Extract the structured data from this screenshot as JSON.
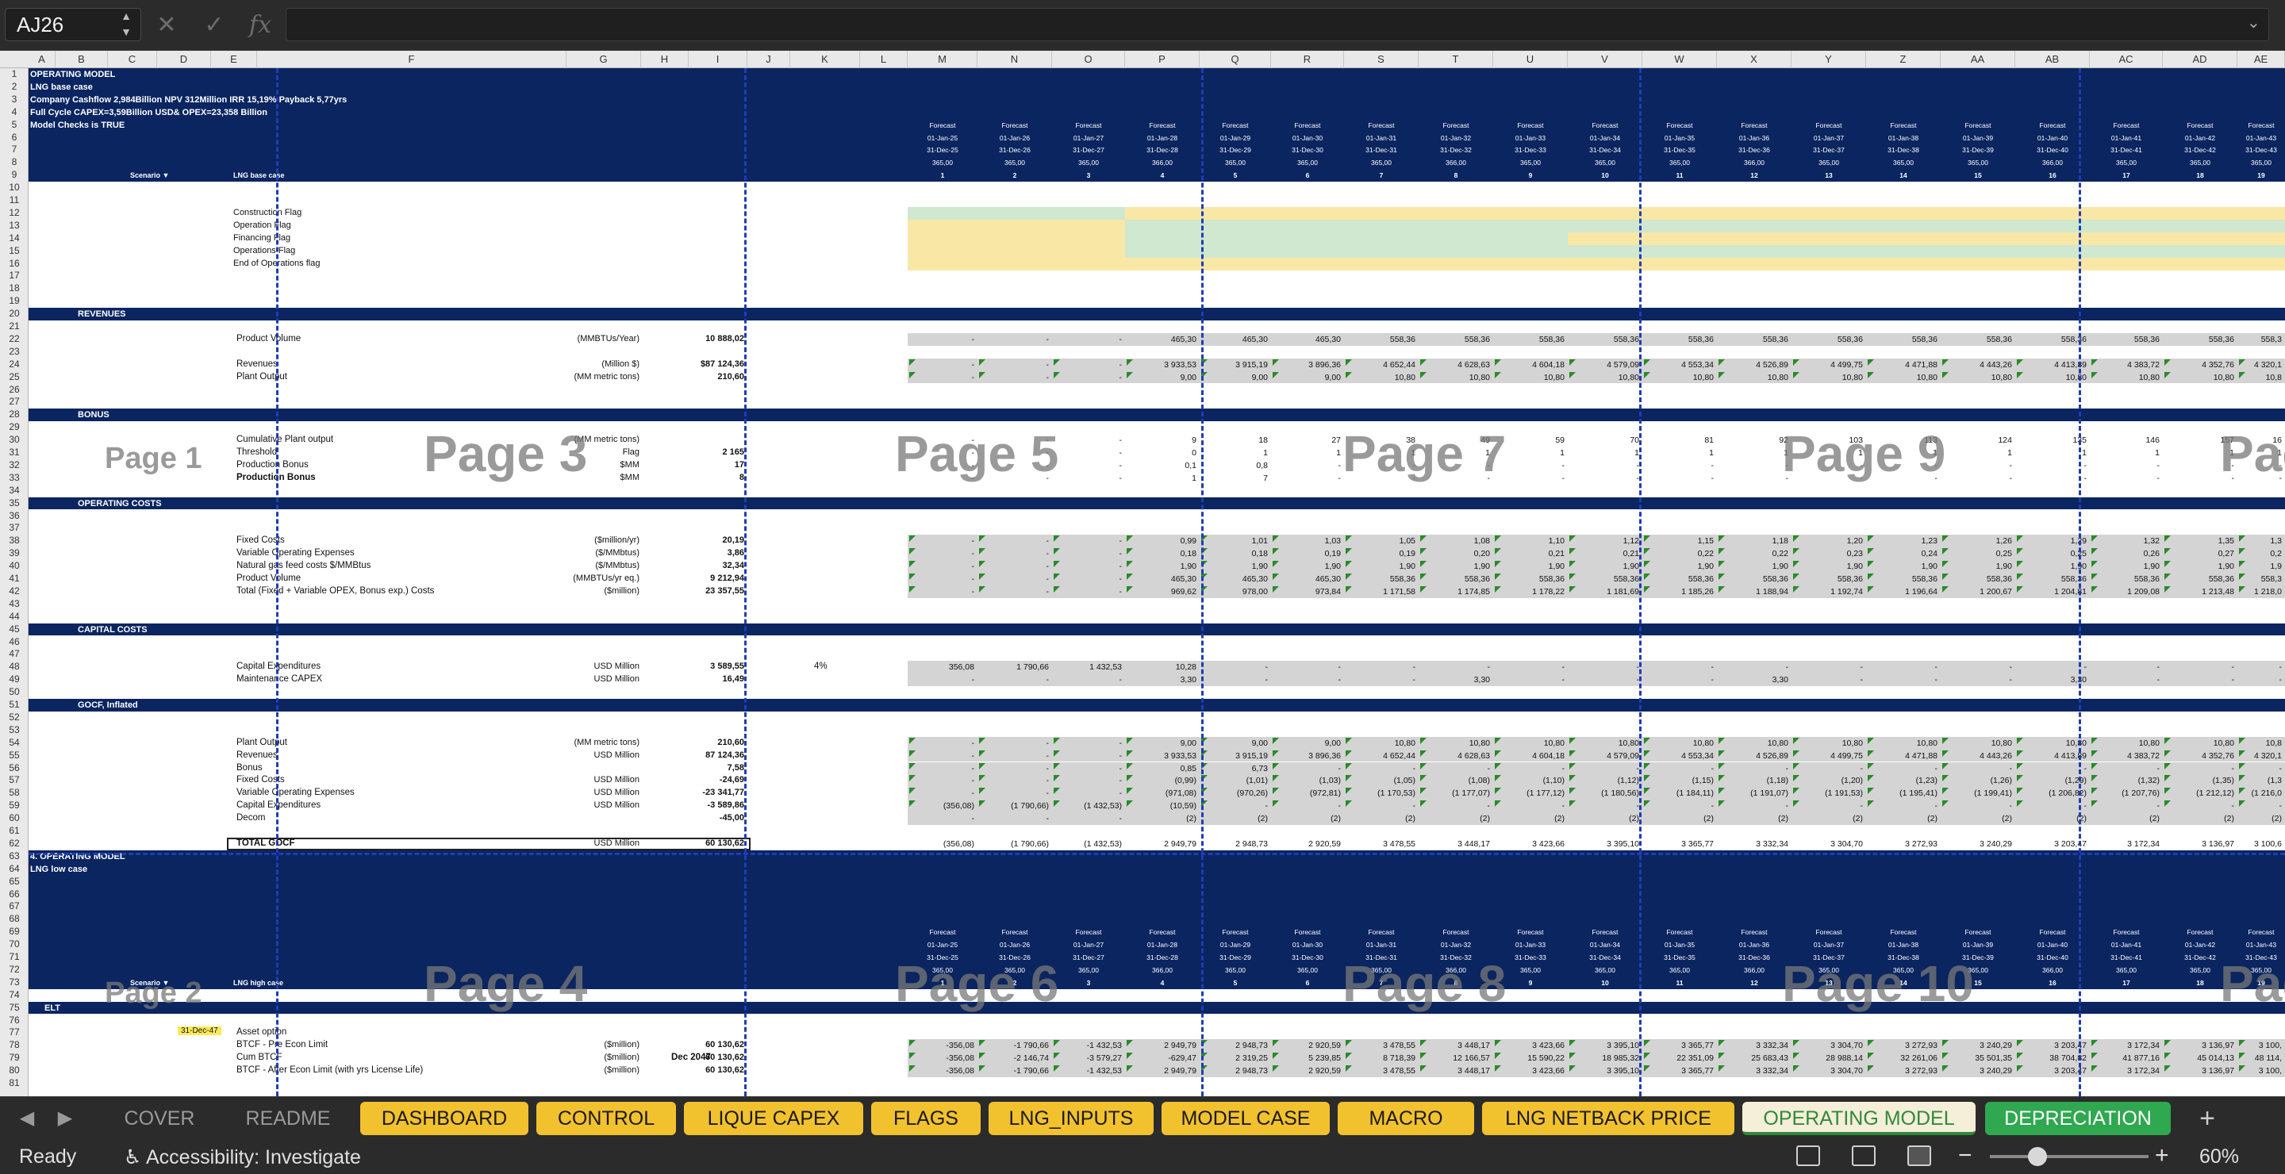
{
  "formula_bar": {
    "cell_ref": "AJ26",
    "formula": "",
    "cancel_icon": "x-icon",
    "enter_icon": "check-icon",
    "fx": "fx"
  },
  "columns": [
    "A",
    "B",
    "C",
    "D",
    "E",
    "F",
    "G",
    "H",
    "I",
    "J",
    "K",
    "L",
    "M",
    "N",
    "O",
    "P",
    "Q",
    "R",
    "S",
    "T",
    "U",
    "V",
    "W",
    "X",
    "Y",
    "Z",
    "AA",
    "AB",
    "AC",
    "AD",
    "AE"
  ],
  "header_top": {
    "title": "OPERATING MODEL",
    "case": "LNG base case",
    "summary1": "Company Cashflow  2,984Billion  NPV 312Million  IRR 15,19%  Payback 5,77yrs",
    "summary2": "Full Cycle CAPEX=3,59Billion USD& OPEX=23,358 Billion",
    "checks": "Model Checks is TRUE",
    "scenario": "Scenario ▼",
    "scenario_value": "LNG base case"
  },
  "periods": [
    {
      "start": "01-Jan-25",
      "end": "31-Dec-25",
      "days": "365,00",
      "n": "1"
    },
    {
      "start": "01-Jan-26",
      "end": "31-Dec-26",
      "days": "365,00",
      "n": "2"
    },
    {
      "start": "01-Jan-27",
      "end": "31-Dec-27",
      "days": "365,00",
      "n": "3"
    },
    {
      "start": "01-Jan-28",
      "end": "31-Dec-28",
      "days": "366,00",
      "n": "4"
    },
    {
      "start": "01-Jan-29",
      "end": "31-Dec-29",
      "days": "365,00",
      "n": "5"
    },
    {
      "start": "01-Jan-30",
      "end": "31-Dec-30",
      "days": "365,00",
      "n": "6"
    },
    {
      "start": "01-Jan-31",
      "end": "31-Dec-31",
      "days": "365,00",
      "n": "7"
    },
    {
      "start": "01-Jan-32",
      "end": "31-Dec-32",
      "days": "366,00",
      "n": "8"
    },
    {
      "start": "01-Jan-33",
      "end": "31-Dec-33",
      "days": "365,00",
      "n": "9"
    },
    {
      "start": "01-Jan-34",
      "end": "31-Dec-34",
      "days": "365,00",
      "n": "10"
    },
    {
      "start": "01-Jan-35",
      "end": "31-Dec-35",
      "days": "365,00",
      "n": "11"
    },
    {
      "start": "01-Jan-36",
      "end": "31-Dec-36",
      "days": "366,00",
      "n": "12"
    },
    {
      "start": "01-Jan-37",
      "end": "31-Dec-37",
      "days": "365,00",
      "n": "13"
    },
    {
      "start": "01-Jan-38",
      "end": "31-Dec-38",
      "days": "365,00",
      "n": "14"
    },
    {
      "start": "01-Jan-39",
      "end": "31-Dec-39",
      "days": "365,00",
      "n": "15"
    },
    {
      "start": "01-Jan-40",
      "end": "31-Dec-40",
      "days": "366,00",
      "n": "16"
    },
    {
      "start": "01-Jan-41",
      "end": "31-Dec-41",
      "days": "365,00",
      "n": "17"
    },
    {
      "start": "01-Jan-42",
      "end": "31-Dec-42",
      "days": "365,00",
      "n": "18"
    },
    {
      "start": "01-Jan-43",
      "end": "31-Dec-43",
      "days": "365,00",
      "n": "19"
    }
  ],
  "forecast_label": "Forecast",
  "flags": [
    "Construction Flag",
    "Operation Flag",
    "Financing Flag",
    "Operations Flag",
    "End of Operations flag"
  ],
  "sections": {
    "revenues": "REVENUES",
    "bonus": "BONUS",
    "opcosts": "OPERATING COSTS",
    "capex": "CAPITAL COSTS",
    "gocf": "GOCF, Inflated",
    "second_title": "4. OPERATING MODEL",
    "second_case": "LNG low case",
    "second_scenario_value": "LNG high case",
    "elt": "ELT"
  },
  "rows": {
    "product_volume": {
      "label": "Product Volume",
      "unit": "(MMBTUs/Year)",
      "total": "10 888,02",
      "vals": [
        "-",
        "-",
        "-",
        "465,30",
        "465,30",
        "465,30",
        "558,36",
        "558,36",
        "558,36",
        "558,36",
        "558,36",
        "558,36",
        "558,36",
        "558,36",
        "558,36",
        "558,36",
        "558,36",
        "558,36",
        "558,3"
      ]
    },
    "revenues": {
      "label": "Revenues",
      "unit": "(Million $)",
      "total": "$87 124,36",
      "vals": [
        "-",
        "-",
        "-",
        "3 933,53",
        "3 915,19",
        "3 896,36",
        "4 652,44",
        "4 628,63",
        "4 604,18",
        "4 579,09",
        "4 553,34",
        "4 526,89",
        "4 499,75",
        "4 471,88",
        "4 443,26",
        "4 413,89",
        "4 383,72",
        "4 352,76",
        "4 320,1"
      ]
    },
    "plant_output": {
      "label": "Plant Output",
      "unit": "(MM metric tons)",
      "total": "210,60",
      "vals": [
        "-",
        "-",
        "-",
        "9,00",
        "9,00",
        "9,00",
        "10,80",
        "10,80",
        "10,80",
        "10,80",
        "10,80",
        "10,80",
        "10,80",
        "10,80",
        "10,80",
        "10,80",
        "10,80",
        "10,80",
        "10,8"
      ]
    },
    "cum_plant": {
      "label": "Cumulative Plant output",
      "unit": "(MM metric tons)",
      "total": "",
      "vals": [
        "-",
        "-",
        "-",
        "9",
        "18",
        "27",
        "38",
        "49",
        "59",
        "70",
        "81",
        "92",
        "103",
        "113",
        "124",
        "135",
        "146",
        "157",
        "16"
      ]
    },
    "threshold": {
      "label": "Threshold",
      "unit": "Flag",
      "total": "2 165",
      "vals": [
        "-",
        "-",
        "-",
        "0",
        "1",
        "1",
        "1",
        "1",
        "1",
        "1",
        "1",
        "1",
        "1",
        "1",
        "1",
        "1",
        "1",
        "1",
        "1"
      ]
    },
    "prod_bonus": {
      "label": "Production Bonus",
      "unit": "$MM",
      "total": "17",
      "vals": [
        "-",
        "-",
        "-",
        "0,1",
        "0,8",
        "-",
        "-",
        "-",
        "-",
        "-",
        "-",
        "-",
        "-",
        "-",
        "-",
        "-",
        "-",
        "-",
        "-"
      ]
    },
    "prod_bonus2": {
      "label": "Production Bonus",
      "unit": "$MM",
      "total": "8",
      "vals": [
        "-",
        "-",
        "-",
        "1",
        "7",
        "-",
        "-",
        "-",
        "-",
        "-",
        "-",
        "-",
        "-",
        "-",
        "-",
        "-",
        "-",
        "-",
        "-"
      ]
    },
    "fixed_costs": {
      "label": "Fixed Costs",
      "unit": "($million/yr)",
      "total": "20,19",
      "vals": [
        "-",
        "-",
        "-",
        "0,99",
        "1,01",
        "1,03",
        "1,05",
        "1,08",
        "1,10",
        "1,12",
        "1,15",
        "1,18",
        "1,20",
        "1,23",
        "1,26",
        "1,29",
        "1,32",
        "1,35",
        "1,3"
      ]
    },
    "var_opex": {
      "label": "Variable Operating Expenses",
      "unit": "($/MMbtus)",
      "total": "3,86",
      "vals": [
        "-",
        "-",
        "-",
        "0,18",
        "0,18",
        "0,19",
        "0,19",
        "0,20",
        "0,21",
        "0,21",
        "0,22",
        "0,22",
        "0,23",
        "0,24",
        "0,25",
        "0,25",
        "0,26",
        "0,27",
        "0,2"
      ]
    },
    "nat_gas": {
      "label": "Natural gas feed costs $/MMBtus",
      "unit": "($/MMbtus)",
      "total": "32,34",
      "vals": [
        "-",
        "-",
        "-",
        "1,90",
        "1,90",
        "1,90",
        "1,90",
        "1,90",
        "1,90",
        "1,90",
        "1,90",
        "1,90",
        "1,90",
        "1,90",
        "1,90",
        "1,90",
        "1,90",
        "1,90",
        "1,9"
      ]
    },
    "prod_volume2": {
      "label": "Product Volume",
      "unit": "(MMBTUs/yr eq.)",
      "total": "9 212,94",
      "vals": [
        "-",
        "-",
        "-",
        "465,30",
        "465,30",
        "465,30",
        "558,36",
        "558,36",
        "558,36",
        "558,36",
        "558,36",
        "558,36",
        "558,36",
        "558,36",
        "558,36",
        "558,36",
        "558,36",
        "558,36",
        "558,3"
      ]
    },
    "total_costs": {
      "label": "Total (Fixed + Variable OPEX, Bonus exp.) Costs",
      "unit": "($million)",
      "total": "23 357,55",
      "vals": [
        "-",
        "-",
        "-",
        "969,62",
        "978,00",
        "973,84",
        "1 171,58",
        "1 174,85",
        "1 178,22",
        "1 181,69",
        "1 185,26",
        "1 188,94",
        "1 192,74",
        "1 196,64",
        "1 200,67",
        "1 204,81",
        "1 209,08",
        "1 213,48",
        "1 218,0"
      ]
    },
    "capex": {
      "label": "Capital Expenditures",
      "unit": "USD Million",
      "total": "3 589,55",
      "extra": "4%",
      "vals": [
        "356,08",
        "1 790,66",
        "1 432,53",
        "10,28",
        "-",
        "-",
        "-",
        "-",
        "-",
        "-",
        "-",
        "-",
        "-",
        "-",
        "-",
        "-",
        "-",
        "-",
        "-"
      ]
    },
    "maint_capex": {
      "label": "Maintenance CAPEX",
      "unit": "USD Million",
      "total": "16,49",
      "vals": [
        "-",
        "-",
        "-",
        "3,30",
        "-",
        "-",
        "-",
        "3,30",
        "-",
        "-",
        "-",
        "3,30",
        "-",
        "-",
        "-",
        "3,30",
        "-",
        "-",
        "-"
      ]
    },
    "g_plant_output": {
      "label": "Plant Output",
      "unit": "(MM metric tons)",
      "total": "210,60",
      "vals": [
        "-",
        "-",
        "-",
        "9,00",
        "9,00",
        "9,00",
        "10,80",
        "10,80",
        "10,80",
        "10,80",
        "10,80",
        "10,80",
        "10,80",
        "10,80",
        "10,80",
        "10,80",
        "10,80",
        "10,80",
        "10,8"
      ]
    },
    "g_revenues": {
      "label": "Revenues",
      "unit": "USD Million",
      "total": "87 124,36",
      "vals": [
        "-",
        "-",
        "-",
        "3 933,53",
        "3 915,19",
        "3 896,36",
        "4 652,44",
        "4 628,63",
        "4 604,18",
        "4 579,09",
        "4 553,34",
        "4 526,89",
        "4 499,75",
        "4 471,88",
        "4 443,26",
        "4 413,89",
        "4 383,72",
        "4 352,76",
        "4 320,1"
      ]
    },
    "g_bonus": {
      "label": "Bonus",
      "unit": "",
      "total": "7,58",
      "vals": [
        "-",
        "-",
        "-",
        "0,85",
        "6,73",
        "-",
        "-",
        "-",
        "-",
        "-",
        "-",
        "-",
        "-",
        "-",
        "-",
        "-",
        "-",
        "-",
        "-"
      ]
    },
    "g_fixed": {
      "label": "Fixed Costs",
      "unit": "USD Million",
      "total": "-24,69",
      "vals": [
        "-",
        "-",
        "-",
        "(0,99)",
        "(1,01)",
        "(1,03)",
        "(1,05)",
        "(1,08)",
        "(1,10)",
        "(1,12)",
        "(1,15)",
        "(1,18)",
        "(1,20)",
        "(1,23)",
        "(1,26)",
        "(1,29)",
        "(1,32)",
        "(1,35)",
        "(1,3"
      ]
    },
    "g_var": {
      "label": "Variable Operating Expenses",
      "unit": "USD Million",
      "total": "-23 341,77",
      "vals": [
        "-",
        "-",
        "-",
        "(971,08)",
        "(970,26)",
        "(972,81)",
        "(1 170,53)",
        "(1 177,07)",
        "(1 177,12)",
        "(1 180,56)",
        "(1 184,11)",
        "(1 191,07)",
        "(1 191,53)",
        "(1 195,41)",
        "(1 199,41)",
        "(1 206,82)",
        "(1 207,76)",
        "(1 212,12)",
        "(1 216,0"
      ]
    },
    "g_capex": {
      "label": "Capital Expenditures",
      "unit": "USD Million",
      "total": "-3 589,86",
      "vals": [
        "(356,08)",
        "(1 790,66)",
        "(1 432,53)",
        "(10,59)",
        "-",
        "-",
        "-",
        "-",
        "-",
        "-",
        "-",
        "-",
        "-",
        "-",
        "-",
        "-",
        "-",
        "-",
        "-"
      ]
    },
    "g_decom": {
      "label": "Decom",
      "unit": "",
      "total": "-45,00",
      "vals": [
        "-",
        "-",
        "-",
        "(2)",
        "(2)",
        "(2)",
        "(2)",
        "(2)",
        "(2)",
        "(2)",
        "(2)",
        "(2)",
        "(2)",
        "(2)",
        "(2)",
        "(2)",
        "(2)",
        "(2)",
        "(2)"
      ]
    },
    "g_total": {
      "label": "TOTAL GOCF",
      "unit": "USD Million",
      "total": "60 130,62",
      "vals": [
        "(356,08)",
        "(1 790,66)",
        "(1 432,53)",
        "2 949,79",
        "2 948,73",
        "2 920,59",
        "3 478,55",
        "3 448,17",
        "3 423,66",
        "3 395,10",
        "3 365,77",
        "3 332,34",
        "3 304,70",
        "3 272,93",
        "3 240,29",
        "3 203,47",
        "3 172,34",
        "3 136,97",
        "3 100,6"
      ]
    },
    "elt_date": "31-Dec-47",
    "asset_option": {
      "label": "Asset option"
    },
    "btcf_pre": {
      "label": "BTCF - Pre Econ Limit",
      "unit": "($million)",
      "total": "60 130,62",
      "vals": [
        "-356,08",
        "-1 790,66",
        "-1 432,53",
        "2 949,79",
        "2 948,73",
        "2 920,59",
        "3 478,55",
        "3 448,17",
        "3 423,66",
        "3 395,10",
        "3 365,77",
        "3 332,34",
        "3 304,70",
        "3 272,93",
        "3 240,29",
        "3 203,47",
        "3 172,34",
        "3 136,97",
        "3 100,"
      ]
    },
    "cum_btcf": {
      "label": "Cum BTCF",
      "unit": "($million)",
      "extra": "Dec 2047",
      "total": "60 130,62",
      "vals": [
        "-356,08",
        "-2 146,74",
        "-3 579,27",
        "-629,47",
        "2 319,25",
        "5 239,85",
        "8 718,39",
        "12 166,57",
        "15 590,22",
        "18 985,32",
        "22 351,09",
        "25 683,43",
        "28 988,14",
        "32 261,06",
        "35 501,35",
        "38 704,82",
        "41 877,16",
        "45 014,13",
        "48 114,"
      ]
    },
    "btcf_after": {
      "label": "BTCF - After Econ Limit (with yrs License Life)",
      "unit": "($million)",
      "total": "60 130,62",
      "vals": [
        "-356,08",
        "-1 790,66",
        "-1 432,53",
        "2 949,79",
        "2 948,73",
        "2 920,59",
        "3 478,55",
        "3 448,17",
        "3 423,66",
        "3 395,10",
        "3 365,77",
        "3 332,34",
        "3 304,70",
        "3 272,93",
        "3 240,29",
        "3 203,47",
        "3 172,34",
        "3 136,97",
        "3 100,"
      ]
    }
  },
  "page_labels": [
    "Page 1",
    "Page 3",
    "Page 5",
    "Page 7",
    "Page 9",
    "Pag",
    "Page 2",
    "Page 4",
    "Page 6",
    "Page 8",
    "Page 10",
    "Pag"
  ],
  "tabs": [
    {
      "label": "COVER",
      "style": "plain"
    },
    {
      "label": "README",
      "style": "plain"
    },
    {
      "label": "DASHBOARD",
      "style": "gold"
    },
    {
      "label": "CONTROL",
      "style": "gold"
    },
    {
      "label": "LIQUE CAPEX",
      "style": "gold"
    },
    {
      "label": "FLAGS",
      "style": "gold"
    },
    {
      "label": "LNG_INPUTS",
      "style": "gold"
    },
    {
      "label": "MODEL CASE",
      "style": "gold"
    },
    {
      "label": "MACRO",
      "style": "gold"
    },
    {
      "label": "LNG NETBACK PRICE",
      "style": "gold"
    },
    {
      "label": "OPERATING MODEL",
      "style": "active"
    },
    {
      "label": "DEPRECIATION",
      "style": "green"
    }
  ],
  "status": {
    "ready": "Ready",
    "accessibility": "Accessibility: Investigate",
    "zoom": "60%",
    "zoom_fraction": 0.3
  },
  "colors": {
    "navy": "#0a2560",
    "green_fill": "#cfe8cf",
    "yellow_fill": "#f9e7a6",
    "gold_tab": "#f2c12e"
  }
}
